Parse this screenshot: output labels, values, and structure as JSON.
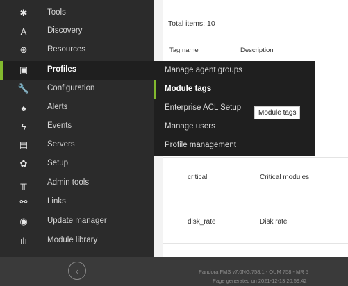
{
  "sidebar": {
    "items": [
      {
        "label": "Tools",
        "icon": "tools-icon",
        "glyph": "✱"
      },
      {
        "label": "Discovery",
        "icon": "discovery-icon",
        "glyph": "A"
      },
      {
        "label": "Resources",
        "icon": "resources-icon",
        "glyph": "⊕"
      },
      {
        "label": "Profiles",
        "icon": "profiles-icon",
        "glyph": "▣",
        "active": true
      },
      {
        "label": "Configuration",
        "icon": "wrench-icon",
        "glyph": "🔧"
      },
      {
        "label": "Alerts",
        "icon": "bell-icon",
        "glyph": "♠"
      },
      {
        "label": "Events",
        "icon": "events-icon",
        "glyph": "ϟ"
      },
      {
        "label": "Servers",
        "icon": "server-icon",
        "glyph": "▤"
      },
      {
        "label": "Setup",
        "icon": "gear-icon",
        "glyph": "✿"
      },
      {
        "label": "Admin tools",
        "icon": "admin-tools-icon",
        "glyph": "╥"
      },
      {
        "label": "Links",
        "icon": "links-icon",
        "glyph": "⚯"
      },
      {
        "label": "Update manager",
        "icon": "update-icon",
        "glyph": "◉"
      },
      {
        "label": "Module library",
        "icon": "library-icon",
        "glyph": "ılı"
      }
    ],
    "collapse_glyph": "‹"
  },
  "submenu": {
    "items": [
      {
        "label": "Manage agent groups"
      },
      {
        "label": "Module tags",
        "active": true
      },
      {
        "label": "Enterprise ACL Setup"
      },
      {
        "label": "Manage users"
      },
      {
        "label": "Profile management"
      }
    ]
  },
  "tooltip": "Module tags",
  "main": {
    "total": "Total items: 10",
    "columns": [
      "Tag name",
      "Description"
    ],
    "rows": [
      {
        "name": "critical",
        "description": "Critical modules"
      },
      {
        "name": "disk_rate",
        "description": "Disk rate"
      }
    ]
  },
  "footer": {
    "line1": "Pandora FMS v7.0NG.758.1 - OUM 758 - MR 5",
    "line2": "Page generated on 2021-12-13 20:59:42"
  },
  "colors": {
    "accent": "#82b92e",
    "sidebar_bg": "#2b2b2b",
    "submenu_bg": "#1f1f1f",
    "footer_bg": "#3a3a3a"
  }
}
